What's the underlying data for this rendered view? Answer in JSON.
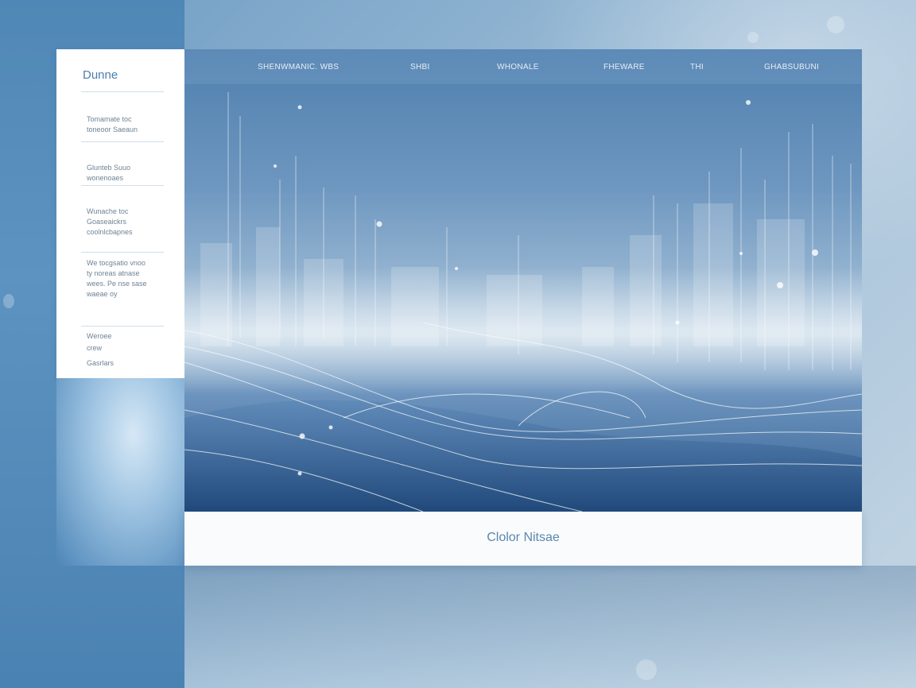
{
  "sidebar": {
    "title": "Dunne",
    "groups": [
      {
        "lines": [
          "Tomamate toc",
          "toneoor Saeaun"
        ]
      },
      {
        "lines": [
          "Glunteb Suuo",
          "wonenoaes"
        ]
      },
      {
        "lines": [
          "Wunache toc",
          "Goaseaickrs",
          "coolnlcbapnes"
        ]
      },
      {
        "lines": [
          "We tocgsatio vnoo",
          "ty noreas atnase",
          "wees. Pe nse sase",
          "waeae oy"
        ]
      },
      {
        "lines": [
          "Weroee",
          "crew",
          "Gasrlars"
        ]
      }
    ]
  },
  "nav": {
    "items": [
      "SHENWMANIC. WBS",
      "SHBI",
      "WHONALE",
      "FHEWARE",
      "THI",
      "GHABSUBUNI"
    ]
  },
  "footer": {
    "text": "Clolor Nitsae"
  }
}
